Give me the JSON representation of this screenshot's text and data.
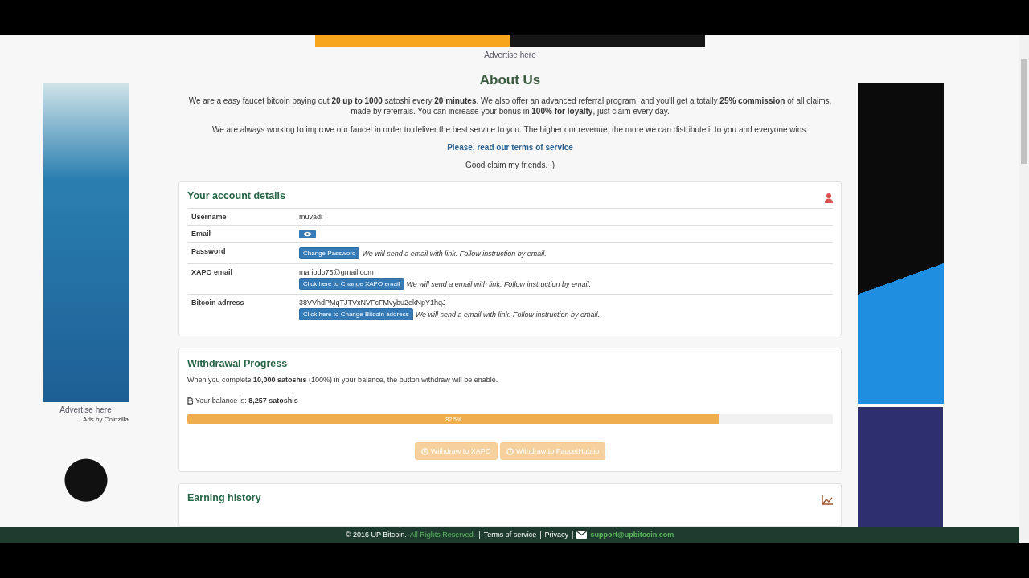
{
  "top_banner": {
    "advertise_link": "Advertise here"
  },
  "left_sidebar": {
    "advertise_link": "Advertise here",
    "ads_by": "Ads by Coinzilla"
  },
  "about": {
    "title": "About Us",
    "paragraphs": [
      "We are a easy faucet bitcoin paying out **20 up to 1000** satoshi every **20 minutes**. We also offer an advanced referral program, and you'll get a totally **25% commission** of all claims, made by referrals. You can increase your bonus in **100% for loyalty**, just claim every day.",
      "We are always working to improve our faucet in order to deliver the best service to you. The higher our revenue, the more we can distribute it to you and everyone wins."
    ],
    "terms_link": "Please, read our terms of service",
    "closing": "Good claim my friends. ;)"
  },
  "account": {
    "title": "Your account details",
    "rows": [
      {
        "kind": "text",
        "label": "Username",
        "value": "muvadi"
      },
      {
        "kind": "reveal",
        "label": "Email"
      },
      {
        "kind": "action",
        "label": "Password",
        "button": "Change Password",
        "note": "We will send a email with link. Follow instruction by email."
      },
      {
        "kind": "action",
        "label": "XAPO email",
        "value": "mariodp75@gmail.com",
        "button": "Click here to Change XAPO email",
        "note": "We will send a email with link. Follow instruction by email."
      },
      {
        "kind": "action",
        "label": "Bitcoin adrress",
        "value": "38VVhdPMqTJTVxNVFcFMvybu2ekNpY1hqJ",
        "button": "Click here to Change Bitcoin address",
        "note": "We will send a email with link. Follow instruction by email."
      }
    ]
  },
  "withdrawal": {
    "title": "Withdrawal Progress",
    "info": "When you complete **10,000 satoshis** (100%) in your balance, the button withdraw will be enable.",
    "balance": "Your balance is: **8,257 satoshis**",
    "progress": {
      "level": 0.825,
      "label": "82.5%"
    },
    "buttons": [
      {
        "label": "Withdraw to XAPO",
        "disabled": true
      },
      {
        "label": "Withdraw to FaucetHub.io",
        "disabled": true
      }
    ]
  },
  "earning": {
    "title": "Earning history"
  },
  "footer": [
    {
      "kind": "text",
      "text": "© 2016 UP Bitcoin."
    },
    {
      "kind": "muted",
      "text": "All Rights Reserved."
    },
    {
      "kind": "text",
      "text": "|"
    },
    {
      "kind": "link",
      "text": "Terms of service"
    },
    {
      "kind": "text",
      "text": "|"
    },
    {
      "kind": "link",
      "text": "Privacy"
    },
    {
      "kind": "text",
      "text": "|"
    },
    {
      "kind": "email",
      "text": "support@upbitcoin.com"
    }
  ]
}
